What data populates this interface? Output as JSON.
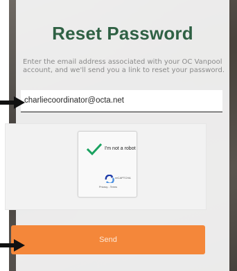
{
  "page": {
    "title": "Reset Password",
    "description": "Enter the email address associated with your OC Vanpool account, and we'll send you a link to reset your password."
  },
  "form": {
    "email_value": "charliecoordinator@octa.net",
    "send_label": "Send"
  },
  "captcha": {
    "label": "I'm not a robot",
    "brand": "reCAPTCHA",
    "links": "Privacy - Terms",
    "checked": true
  },
  "colors": {
    "title": "#2f6144",
    "button": "#f4873a",
    "check": "#1aa260"
  },
  "icons": {
    "annotation_arrow": "arrow-right-icon",
    "captcha_check": "checkmark-icon",
    "captcha_logo": "recaptcha-logo-icon"
  }
}
